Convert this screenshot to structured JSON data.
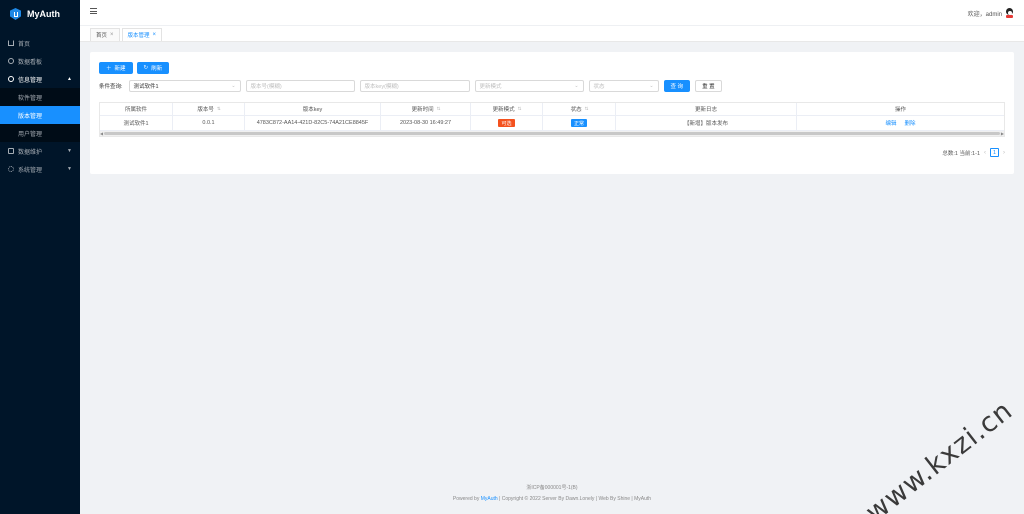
{
  "app": {
    "name": "MyAuth"
  },
  "sidebar": {
    "items": [
      {
        "label": "首页",
        "icon": "home-icon"
      },
      {
        "label": "数据看板",
        "icon": "dashboard-icon"
      },
      {
        "label": "信息管理",
        "icon": "info-icon",
        "open": true,
        "children": [
          {
            "label": "软件管理"
          },
          {
            "label": "版本管理",
            "active": true
          },
          {
            "label": "用户管理"
          }
        ]
      },
      {
        "label": "数据维护",
        "icon": "database-icon"
      },
      {
        "label": "系统管理",
        "icon": "settings-icon"
      }
    ]
  },
  "header": {
    "welcome": "欢迎，admin"
  },
  "tabs": [
    {
      "label": "首页",
      "active": false
    },
    {
      "label": "版本管理",
      "active": true
    }
  ],
  "toolbar": {
    "new_label": "新建",
    "refresh_label": "刷新"
  },
  "filter": {
    "label": "条件查询:",
    "software_value": "测试软件1",
    "version_placeholder": "版本号(模糊)",
    "key_placeholder": "版本key(模糊)",
    "mode_placeholder": "更新模式",
    "status_placeholder": "状态",
    "search_label": "查 询",
    "reset_label": "重 置"
  },
  "table": {
    "columns": [
      "所属软件",
      "版本号",
      "版本key",
      "更新时间",
      "更新模式",
      "状态",
      "更新日志",
      "操作"
    ],
    "rows": [
      {
        "software": "测试软件1",
        "version": "0.0.1",
        "key": "4783C872-AA14-421D-82C5-74A21CE8845F",
        "updated": "2023-08-30 16:49:27",
        "mode": "可选",
        "status": "正常",
        "log": "【新增】版本发布",
        "edit_label": "编辑",
        "delete_label": "删除"
      }
    ]
  },
  "pagination": {
    "summary": "总数:1 当前:1-1",
    "current_page": "1"
  },
  "footer": {
    "icp": "浙ICP备000001号-1(B)",
    "powered_prefix": "Powered by",
    "powered_link": "MyAuth",
    "rest": "| Copyright © 2022 Server By Dawn.Lonely | Web By Shine | MyAuth"
  },
  "watermark": "www.kxzi.cn",
  "colors": {
    "primary": "#1890ff",
    "sidebar": "#001529",
    "tag_orange": "#f4511e"
  }
}
